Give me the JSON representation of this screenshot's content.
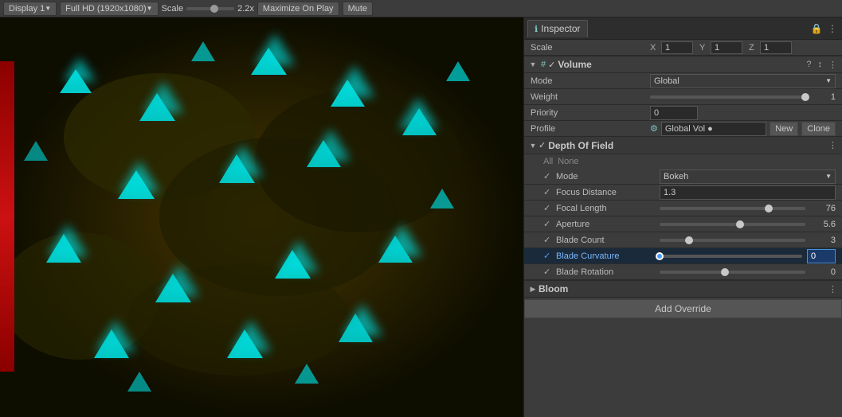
{
  "toolbar": {
    "display": "Display 1",
    "resolution": "Full HD (1920x1080)",
    "scale_label": "Scale",
    "scale_value": "2.2x",
    "maximize_on_play": "Maximize On Play",
    "mute": "Mute"
  },
  "inspector": {
    "tab_label": "Inspector",
    "lock_icon": "🔒",
    "menu_icon": "☰",
    "scale_label": "Scale",
    "scale_x": "1",
    "scale_y": "1",
    "scale_z": "1"
  },
  "volume": {
    "title": "Volume",
    "mode_label": "Mode",
    "mode_value": "Global",
    "weight_label": "Weight",
    "weight_value": "1",
    "weight_pct": 100,
    "priority_label": "Priority",
    "priority_value": "0",
    "profile_label": "Profile",
    "profile_icon": "⚙",
    "profile_name": "Global Vol ●",
    "btn_new": "New",
    "btn_clone": "Clone"
  },
  "depth_of_field": {
    "title": "Depth Of Field",
    "all_label": "All",
    "none_label": "None",
    "mode_label": "Mode",
    "mode_value": "Bokeh",
    "focus_distance_label": "Focus Distance",
    "focus_distance_value": "1.3",
    "focal_length_label": "Focal Length",
    "focal_length_value": "76",
    "focal_length_pct": 75,
    "aperture_label": "Aperture",
    "aperture_value": "5.6",
    "aperture_pct": 55,
    "blade_count_label": "Blade Count",
    "blade_count_value": "3",
    "blade_count_pct": 20,
    "blade_curvature_label": "Blade Curvature",
    "blade_curvature_value": "0",
    "blade_curvature_pct": 0,
    "blade_rotation_label": "Blade Rotation",
    "blade_rotation_value": "0",
    "blade_rotation_pct": 45
  },
  "bloom": {
    "title": "Bloom"
  },
  "add_override": {
    "label": "Add Override"
  }
}
